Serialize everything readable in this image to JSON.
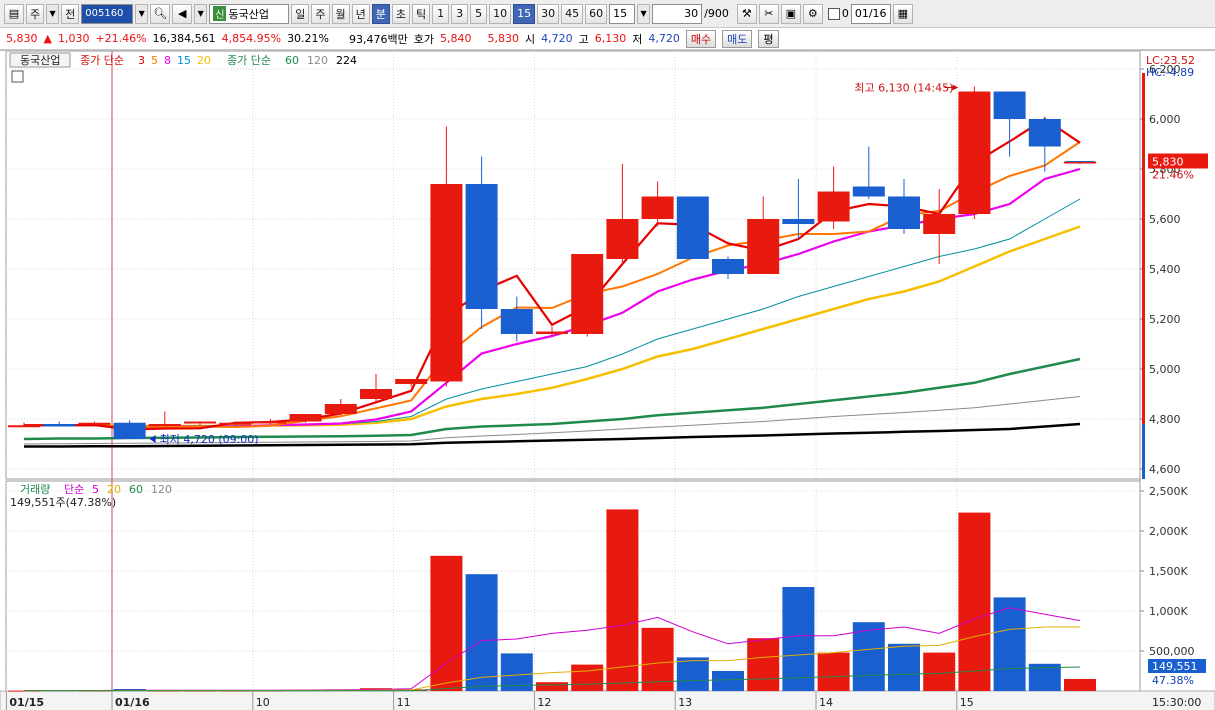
{
  "toolbar": {
    "market": "주",
    "prefix": "전",
    "code": "005160",
    "name_badge": "신",
    "name": "동국산업",
    "periods": [
      "일",
      "주",
      "월",
      "년"
    ],
    "intervals": [
      "분",
      "초",
      "틱"
    ],
    "active_interval": "분",
    "minutes": [
      "1",
      "3",
      "5",
      "10",
      "15",
      "30",
      "45",
      "60"
    ],
    "active_minute": "15",
    "minute_select": "15",
    "count": "30",
    "count_max": "/900",
    "check_label": "0",
    "date": "01/16"
  },
  "quote": {
    "price": "5,830",
    "arrow": "▲",
    "change": "1,030",
    "change_pct": "+21.46%",
    "volume": "16,384,561",
    "volume_ratio": "4,854.95%",
    "turnover": "30.21%",
    "amount": "93,476백만",
    "ask_label": "호가",
    "ask": "5,840",
    "bid": "5,830",
    "open_label": "시",
    "open": "4,720",
    "high_label": "고",
    "high": "6,130",
    "low_label": "저",
    "low": "4,720",
    "buy_label": "매수",
    "sell_label": "매도",
    "avg_label": "평"
  },
  "legend": {
    "name": "동국산업",
    "ma_label": "종가 단순",
    "ma_short": [
      "3",
      "5",
      "8",
      "15",
      "20"
    ],
    "ma_short_colors": [
      "#e60000",
      "#ff7700",
      "#ee00ee",
      "#008fd8",
      "#f5c000"
    ],
    "ma_long_label": "종가 단순",
    "ma_long": [
      "60",
      "120",
      "224"
    ],
    "ma_long_colors": [
      "#1f8a4c",
      "#8a8a8a",
      "#000000"
    ],
    "vol_label": "거래량",
    "vol_ma_label": "단순",
    "vol_ma": [
      "5",
      "20",
      "60",
      "120"
    ],
    "vol_ma_colors": [
      "#cc00cc",
      "#e0b000",
      "#1f8a4c",
      "#8a8a8a"
    ],
    "vol_current": "149,551주(47.38%)"
  },
  "annotations": {
    "high": "최고 6,130 (14:45)",
    "low": "최저 4,720 (09:00)",
    "lc": "LC:23.52",
    "hc": "HC:-4.89",
    "price_tag": "5,830",
    "pct_tag": "21.46%",
    "vol_tag": "149,551",
    "vol_pct_tag": "47.38%",
    "time_label": "15:30:00"
  },
  "colors": {
    "up": "#e8190f",
    "down": "#1a5fcf",
    "ma3": "#e60000",
    "ma5": "#ff7700",
    "ma8": "#ee00ee",
    "ma15": "#008fa0",
    "ma20": "#f5c000",
    "ma60": "#1f8a4c",
    "ma120": "#8a8a8a",
    "ma224": "#000000"
  },
  "chart_data": {
    "type": "candlestick",
    "title": "동국산업",
    "interval": "15분",
    "price_ticks": [
      "6,200",
      "6,000",
      "5,800",
      "5,600",
      "5,400",
      "5,200",
      "5,000",
      "4,800",
      "4,600"
    ],
    "price_tick_values": [
      6200,
      6000,
      5800,
      5600,
      5400,
      5200,
      5000,
      4800,
      4600
    ],
    "ylim": [
      4580,
      6220
    ],
    "volume_ticks": [
      "2,500K",
      "2,000K",
      "1,500K",
      "1,000K",
      "500,000"
    ],
    "volume_tick_values": [
      2500,
      2000,
      1500,
      1000,
      500
    ],
    "volume_ylim": [
      0,
      2600
    ],
    "x_labels": [
      {
        "index": 0,
        "label": "01/15"
      },
      {
        "index": 3,
        "label": "01/16"
      },
      {
        "index": 7,
        "label": "10"
      },
      {
        "index": 11,
        "label": "11"
      },
      {
        "index": 15,
        "label": "12"
      },
      {
        "index": 19,
        "label": "13"
      },
      {
        "index": 23,
        "label": "14"
      },
      {
        "index": 27,
        "label": "15"
      }
    ],
    "candles": [
      {
        "o": 4775,
        "h": 4785,
        "l": 4770,
        "c": 4775,
        "v": 5
      },
      {
        "o": 4780,
        "h": 4790,
        "l": 4770,
        "c": 4770,
        "v": 8
      },
      {
        "o": 4780,
        "h": 4790,
        "l": 4775,
        "c": 4785,
        "v": 6
      },
      {
        "o": 4785,
        "h": 4795,
        "l": 4720,
        "c": 4720,
        "v": 25
      },
      {
        "o": 4780,
        "h": 4830,
        "l": 4770,
        "c": 4780,
        "v": 6
      },
      {
        "o": 4785,
        "h": 4790,
        "l": 4775,
        "c": 4790,
        "v": 6
      },
      {
        "o": 4780,
        "h": 4790,
        "l": 4775,
        "c": 4785,
        "v": 6
      },
      {
        "o": 4785,
        "h": 4800,
        "l": 4780,
        "c": 4790,
        "v": 8
      },
      {
        "o": 4790,
        "h": 4820,
        "l": 4785,
        "c": 4820,
        "v": 12
      },
      {
        "o": 4820,
        "h": 4880,
        "l": 4815,
        "c": 4860,
        "v": 20
      },
      {
        "o": 4880,
        "h": 4980,
        "l": 4870,
        "c": 4920,
        "v": 35
      },
      {
        "o": 4940,
        "h": 4960,
        "l": 4930,
        "c": 4960,
        "v": 20
      },
      {
        "o": 4950,
        "h": 5970,
        "l": 4930,
        "c": 5740,
        "v": 1690
      },
      {
        "o": 5740,
        "h": 5850,
        "l": 5160,
        "c": 5240,
        "v": 1460
      },
      {
        "o": 5240,
        "h": 5290,
        "l": 5110,
        "c": 5140,
        "v": 470
      },
      {
        "o": 5140,
        "h": 5170,
        "l": 5130,
        "c": 5150,
        "v": 110
      },
      {
        "o": 5140,
        "h": 5460,
        "l": 5130,
        "c": 5460,
        "v": 330
      },
      {
        "o": 5440,
        "h": 5820,
        "l": 5420,
        "c": 5600,
        "v": 2270
      },
      {
        "o": 5600,
        "h": 5750,
        "l": 5570,
        "c": 5690,
        "v": 790
      },
      {
        "o": 5690,
        "h": 5690,
        "l": 5440,
        "c": 5440,
        "v": 420
      },
      {
        "o": 5440,
        "h": 5450,
        "l": 5360,
        "c": 5380,
        "v": 250
      },
      {
        "o": 5380,
        "h": 5690,
        "l": 5380,
        "c": 5600,
        "v": 660
      },
      {
        "o": 5600,
        "h": 5760,
        "l": 5520,
        "c": 5580,
        "v": 1300
      },
      {
        "o": 5590,
        "h": 5810,
        "l": 5560,
        "c": 5710,
        "v": 480
      },
      {
        "o": 5730,
        "h": 5890,
        "l": 5680,
        "c": 5690,
        "v": 860
      },
      {
        "o": 5690,
        "h": 5760,
        "l": 5540,
        "c": 5560,
        "v": 590
      },
      {
        "o": 5540,
        "h": 5720,
        "l": 5420,
        "c": 5620,
        "v": 480
      },
      {
        "o": 5620,
        "h": 6130,
        "l": 5600,
        "c": 6110,
        "v": 2230
      },
      {
        "o": 6110,
        "h": 6110,
        "l": 5850,
        "c": 6000,
        "v": 1170
      },
      {
        "o": 6000,
        "h": 6010,
        "l": 5790,
        "c": 5890,
        "v": 340
      },
      {
        "o": 5830,
        "h": 5830,
        "l": 5820,
        "c": 5830,
        "v": 150
      }
    ],
    "series": [
      {
        "name": "3",
        "values": [
          4775,
          4775,
          4776,
          4758,
          4762,
          4763,
          4785,
          4788,
          4798,
          4822,
          4867,
          4913,
          5207,
          5313,
          5373,
          5177,
          5250,
          5420,
          5583,
          5577,
          5503,
          5473,
          5520,
          5630,
          5660,
          5650,
          5620,
          5825,
          5910,
          6000,
          5905
        ]
      },
      {
        "name": "5",
        "values": [
          4775,
          4775,
          4776,
          4767,
          4768,
          4770,
          4768,
          4773,
          4793,
          4811,
          4843,
          4874,
          5054,
          5168,
          5246,
          5244,
          5301,
          5330,
          5380,
          5446,
          5494,
          5514,
          5540,
          5540,
          5550,
          5615,
          5632,
          5707,
          5772,
          5814,
          5908
        ]
      },
      {
        "name": "8",
        "values": [
          4775,
          4775,
          4776,
          4765,
          4770,
          4770,
          4770,
          4775,
          4778,
          4782,
          4798,
          4830,
          4945,
          5062,
          5100,
          5132,
          5175,
          5225,
          5310,
          5358,
          5394,
          5420,
          5460,
          5510,
          5550,
          5575,
          5600,
          5620,
          5660,
          5760,
          5800
        ]
      },
      {
        "name": "15",
        "values": [
          4775,
          4775,
          4775,
          4770,
          4772,
          4773,
          4773,
          4775,
          4776,
          4780,
          4790,
          4810,
          4880,
          4920,
          4950,
          4980,
          5010,
          5060,
          5120,
          5160,
          5200,
          5240,
          5290,
          5330,
          5370,
          5410,
          5450,
          5480,
          5520,
          5600,
          5680
        ]
      },
      {
        "name": "20",
        "values": [
          4775,
          4775,
          4775,
          4772,
          4772,
          4772,
          4772,
          4774,
          4775,
          4777,
          4785,
          4800,
          4850,
          4880,
          4900,
          4925,
          4960,
          5000,
          5050,
          5080,
          5120,
          5160,
          5200,
          5240,
          5280,
          5310,
          5350,
          5410,
          5470,
          5520,
          5570
        ]
      },
      {
        "name": "60",
        "values": [
          4720,
          4722,
          4722,
          4724,
          4725,
          4726,
          4728,
          4729,
          4730,
          4731,
          4733,
          4736,
          4760,
          4770,
          4775,
          4780,
          4790,
          4800,
          4815,
          4825,
          4835,
          4845,
          4860,
          4875,
          4890,
          4905,
          4925,
          4945,
          4980,
          5010,
          5040
        ]
      },
      {
        "name": "120",
        "values": [
          4700,
          4701,
          4702,
          4703,
          4704,
          4705,
          4706,
          4707,
          4708,
          4709,
          4710,
          4712,
          4725,
          4732,
          4738,
          4745,
          4752,
          4760,
          4768,
          4775,
          4783,
          4790,
          4800,
          4810,
          4818,
          4826,
          4835,
          4845,
          4860,
          4875,
          4890
        ]
      },
      {
        "name": "224",
        "values": [
          4690,
          4690,
          4691,
          4691,
          4692,
          4693,
          4694,
          4695,
          4696,
          4697,
          4698,
          4699,
          4705,
          4708,
          4711,
          4714,
          4717,
          4720,
          4724,
          4728,
          4731,
          4734,
          4738,
          4742,
          4745,
          4749,
          4752,
          4756,
          4760,
          4770,
          4780
        ]
      }
    ],
    "volume_series": [
      {
        "name": "5",
        "values": [
          5,
          6,
          6,
          10,
          10,
          10,
          10,
          10,
          12,
          14,
          20,
          28,
          350,
          630,
          650,
          720,
          760,
          820,
          920,
          740,
          590,
          640,
          690,
          690,
          760,
          800,
          720,
          900,
          1040,
          960,
          880
        ]
      },
      {
        "name": "20",
        "values": [
          4,
          5,
          5,
          6,
          6,
          6,
          6,
          6,
          7,
          8,
          10,
          12,
          100,
          170,
          200,
          230,
          250,
          300,
          350,
          380,
          380,
          420,
          450,
          480,
          520,
          560,
          570,
          680,
          770,
          800,
          800
        ]
      },
      {
        "name": "60",
        "values": [
          2,
          2,
          2,
          2,
          2,
          2,
          2,
          2,
          3,
          3,
          3,
          4,
          30,
          60,
          70,
          75,
          85,
          100,
          115,
          130,
          140,
          150,
          165,
          180,
          195,
          210,
          220,
          250,
          280,
          290,
          300
        ]
      }
    ]
  }
}
